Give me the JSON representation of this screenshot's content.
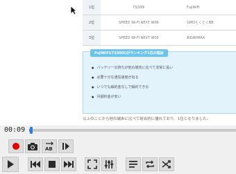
{
  "video_frame": {
    "table_rows": [
      {
        "rank": "1位",
        "model": "TS300i",
        "network": "FujiWiFi"
      },
      {
        "rank": "2位",
        "model": "SPEED Wi-Fi NEXT W06",
        "network": "GMOとくとくBB"
      },
      {
        "rank": "3位",
        "model": "SPEED Wi-Fi NEXT W05",
        "network": "BIGWIMAX"
      }
    ],
    "box_title": "FujiWiFi(TS300i)がランキング1位の理由",
    "reasons": [
      "バッテリーの持ちが他の端末に比べて非常に長い",
      "必要十分な通信速度が出る",
      "いつでも解約金なしで解約できる",
      "月額料金が安い"
    ],
    "caption": "以上のことから他の端末に比べて総合的に優れており、1位となりました。"
  },
  "player": {
    "time": "00:09",
    "progress_fraction": 0.015,
    "accent_color": "#2f7fd8",
    "record_color": "#e00000"
  }
}
